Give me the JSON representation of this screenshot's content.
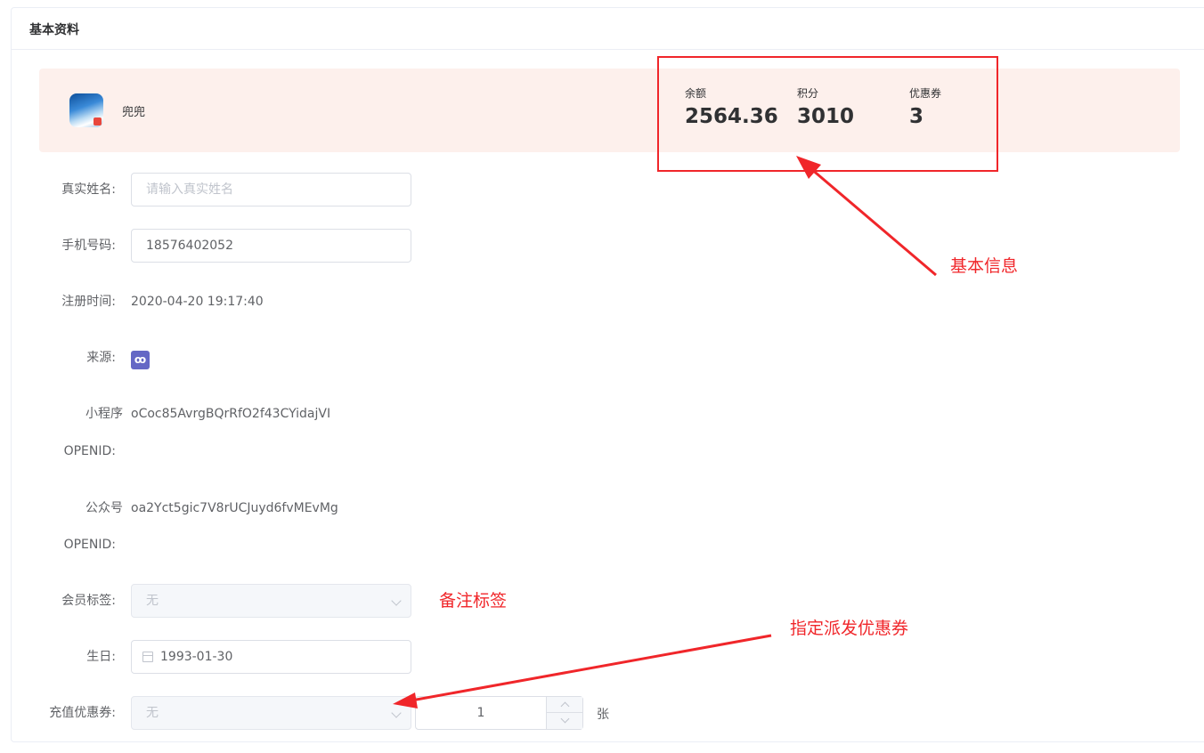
{
  "card": {
    "title": "基本资料"
  },
  "member": {
    "nickname": "兜兜",
    "stats": [
      {
        "label": "余额",
        "value": "2564.36"
      },
      {
        "label": "积分",
        "value": "3010"
      },
      {
        "label": "优惠券",
        "value": "3"
      }
    ]
  },
  "form": {
    "real_name": {
      "label": "真实姓名:",
      "placeholder": "请输入真实姓名"
    },
    "phone": {
      "label": "手机号码:",
      "value": "18576402052"
    },
    "register_time": {
      "label": "注册时间:",
      "value": "2020-04-20 19:17:40"
    },
    "source": {
      "label": "来源:",
      "icon": "mini-program-icon"
    },
    "mini_openid": {
      "label_line1": "小程序",
      "label_line2": "OPENID:",
      "value": "oCoc85AvrgBQrRfO2f43CYidajVI"
    },
    "mp_openid": {
      "label_line1": "公众号",
      "label_line2": "OPENID:",
      "value": "oa2Yct5gic7V8rUCJuyd6fvMEvMg"
    },
    "member_tag": {
      "label": "会员标签:",
      "value": "无"
    },
    "birthday": {
      "label": "生日:",
      "value": "1993-01-30"
    },
    "recharge_coupon": {
      "label": "充值优惠券:",
      "value": "无",
      "quantity": "1",
      "unit": "张"
    }
  },
  "annotations": {
    "basic_info": "基本信息",
    "remark_tag": "备注标签",
    "assign_coupon": "指定派发优惠券"
  },
  "colors": {
    "annotation_red": "#f0262a",
    "banner_bg": "#fdf0ec",
    "source_icon": "#6467c5"
  }
}
